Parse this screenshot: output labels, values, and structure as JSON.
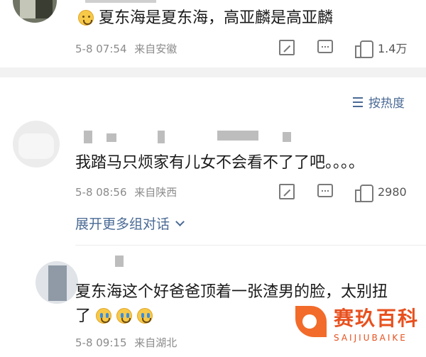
{
  "comments": [
    {
      "text": "夏东海是夏东海，高亚麟是高亚麟",
      "date": "5-8 07:54",
      "source": "来自安徽",
      "likes": "1.4万"
    },
    {
      "text": "我踏马只烦家有儿女不会看不了了吧。。。。",
      "date": "5-8 08:56",
      "source": "来自陕西",
      "likes": "2980"
    },
    {
      "text_line1": "夏东海这个好爸爸顶着一张渣男的脸，太别扭",
      "text_line2": "了",
      "date": "5-8 09:15",
      "source": "来自湖北"
    }
  ],
  "sort": {
    "label": "按热度"
  },
  "expand": {
    "label": "展开更多组对话"
  },
  "watermark": {
    "title": "赛玖百科",
    "subtitle": "SAIJIUBAIKE"
  },
  "icons": [
    "share-icon",
    "comment-icon",
    "like-icon",
    "sort-icon",
    "chevron-down-icon",
    "emoji-icon",
    "crying-emoji-icon"
  ],
  "colors": {
    "link": "#4a6a95",
    "meta": "#8b8b8b",
    "watermark": "#e8501e"
  }
}
